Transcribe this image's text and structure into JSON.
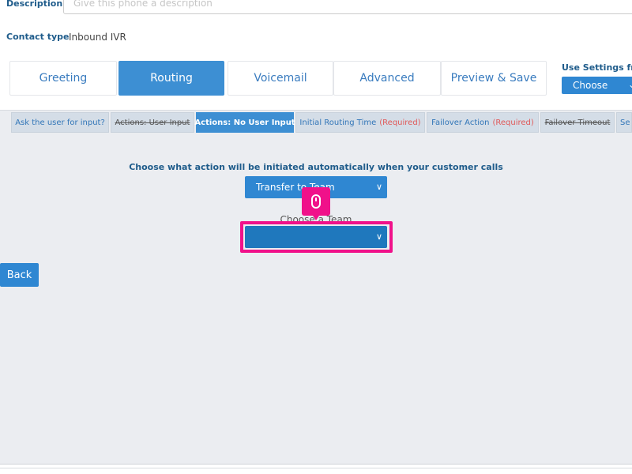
{
  "description": {
    "label": "Description",
    "placeholder": "Give this phone a description"
  },
  "contact": {
    "label": "Contact type",
    "value": "Inbound IVR"
  },
  "tabs": [
    {
      "label": "Greeting",
      "active": false
    },
    {
      "label": "Routing",
      "active": true
    },
    {
      "label": "Voicemail",
      "active": false
    },
    {
      "label": "Advanced",
      "active": false
    },
    {
      "label": "Preview & Save",
      "active": false
    }
  ],
  "settings": {
    "label": "Use Settings from",
    "select_value": "Choose"
  },
  "subtabs": [
    {
      "label": "Ask the user for input?",
      "state": "normal"
    },
    {
      "label": "Actions: User Input",
      "state": "strike"
    },
    {
      "label": "Actions: No User Input",
      "state": "active"
    },
    {
      "label": "Initial Routing Time",
      "required": "(Required)"
    },
    {
      "label": "Failover Action",
      "required": "(Required)"
    },
    {
      "label": "Failover Timeout",
      "state": "strike"
    },
    {
      "label": "Se",
      "state": "normal"
    }
  ],
  "routing": {
    "prompt": "Choose what action will be initiated automatically when your customer calls",
    "action_value": "Transfer to Team",
    "team_label": "Choose a Team",
    "team_value": ""
  },
  "back_label": "Back",
  "icons": {
    "chevron": "chevron-down-icon",
    "cursor": "mouse-icon"
  },
  "colors": {
    "accent": "#3d8fd3",
    "highlight": "#f0118a",
    "required": "#e05a5a"
  }
}
